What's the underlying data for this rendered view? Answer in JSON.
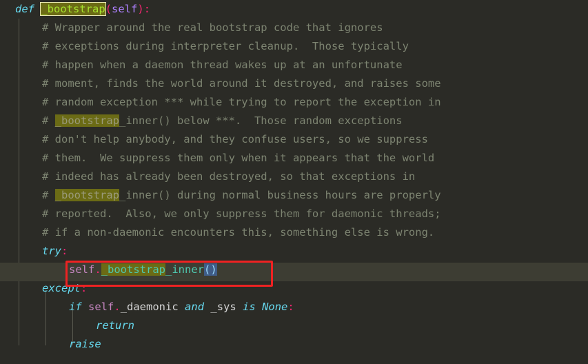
{
  "editor": {
    "background": "#2b2b26",
    "current_line_background": "#3d3d33",
    "search_highlight_background": "#6b6b15",
    "search_highlight_border": "#e8e8b0",
    "bracket_match_background": "#3f5c87",
    "annotation_color": "#ee2222",
    "indent_guide_color": "#5a5a50"
  },
  "code": {
    "def_line": {
      "keyword": "def",
      "space1": " ",
      "name": "_bootstrap",
      "open_paren": "(",
      "param": "self",
      "close_paren": ")",
      "colon": ":"
    },
    "comments": [
      "# Wrapper around the real bootstrap code that ignores",
      "# exceptions during interpreter cleanup.  Those typically",
      "# happen when a daemon thread wakes up at an unfortunate",
      "# moment, finds the world around it destroyed, and raises some",
      "# random exception *** while trying to report the exception in"
    ],
    "comment_hit_1": {
      "prefix": "# ",
      "hit": "_bootstrap",
      "suffix": "_inner() below ***.  Those random exceptions"
    },
    "comments_2": [
      "# don't help anybody, and they confuse users, so we suppress",
      "# them.  We suppress them only when it appears that the world",
      "# indeed has already been destroyed, so that exceptions in"
    ],
    "comment_hit_2": {
      "prefix": "# ",
      "hit": "_bootstrap",
      "suffix": "_inner() during normal business hours are properly"
    },
    "comments_3": [
      "# reported.  Also, we only suppress them for daemonic threads;",
      "# if a non-daemonic encounters this, something else is wrong."
    ],
    "try_line": {
      "keyword": "try",
      "colon": ":"
    },
    "call_line": {
      "self": "self",
      "dot": ".",
      "hit": "_bootstrap",
      "rest": "_inner",
      "brackets": "()"
    },
    "except_line": {
      "keyword": "except",
      "colon": ":"
    },
    "if_line": {
      "kw_if": "if",
      "self": "self",
      "dot": ".",
      "attr": "_daemonic",
      "kw_and": "and",
      "var": "_sys",
      "kw_is": "is",
      "kw_none": "None",
      "colon": ":"
    },
    "return_line": "return",
    "raise_line": "raise"
  }
}
